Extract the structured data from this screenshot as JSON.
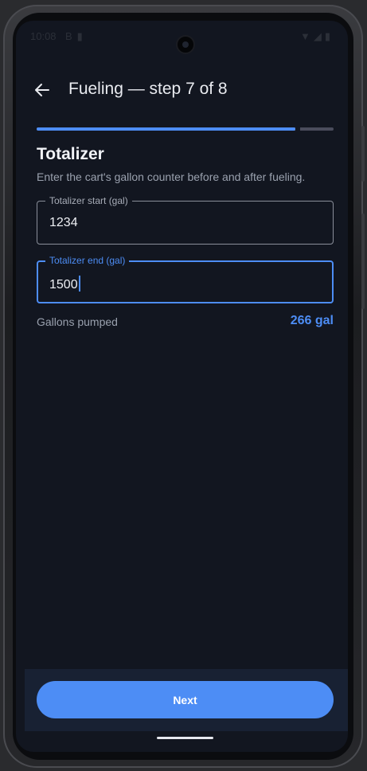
{
  "status_bar": {
    "time": "10:08",
    "left_icons": [
      "notification-icon",
      "sim-card-icon"
    ],
    "right_icons": [
      "wifi-icon",
      "signal-icon",
      "battery-icon"
    ]
  },
  "header": {
    "back_icon": "arrow-left-icon",
    "title": "Fueling — step 7 of 8"
  },
  "progress": {
    "current_step": 7,
    "total_steps": 8,
    "fraction": 0.875,
    "accent_color": "#4d8df5",
    "track_color": "#4a4c5c"
  },
  "section": {
    "title": "Totalizer",
    "description": "Enter the cart's gallon counter before and after fueling."
  },
  "fields": {
    "start": {
      "label": "Totalizer start (gal)",
      "value": "1234"
    },
    "end": {
      "label": "Totalizer end (gal)",
      "value": "1500",
      "focused": true
    }
  },
  "summary": {
    "label": "Gallons pumped",
    "value": "266 gal"
  },
  "footer": {
    "next_label": "Next"
  },
  "colors": {
    "background": "#121620",
    "accent": "#4d8df5",
    "footer_panel": "#182133"
  }
}
